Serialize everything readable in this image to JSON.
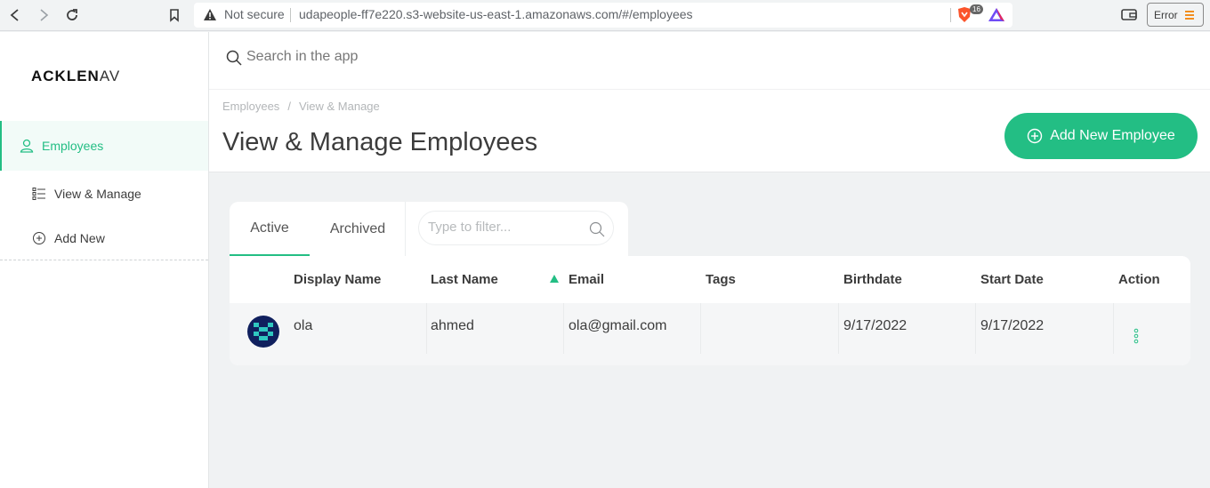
{
  "browser": {
    "not_secure": "Not secure",
    "url": "udapeople-ff7e220.s3-website-us-east-1.amazonaws.com/#/employees",
    "ext_badge": "16",
    "error_label": "Error"
  },
  "sidebar": {
    "logo_bold": "ACKLEN",
    "logo_rest": "AV",
    "items": [
      {
        "label": "Employees"
      },
      {
        "label": "View & Manage"
      },
      {
        "label": "Add New"
      }
    ]
  },
  "search": {
    "placeholder": "Search in the app"
  },
  "header": {
    "breadcrumb": [
      "Employees",
      "/",
      "View & Manage"
    ],
    "title": "View & Manage Employees",
    "add_button": "Add New Employee"
  },
  "tabs": [
    {
      "label": "Active"
    },
    {
      "label": "Archived"
    }
  ],
  "filter": {
    "placeholder": "Type to filter..."
  },
  "table": {
    "columns": [
      "Display Name",
      "Last Name",
      "Email",
      "Tags",
      "Birthdate",
      "Start Date",
      "Action"
    ],
    "rows": [
      {
        "display_name": "ola",
        "last_name": "ahmed",
        "email": "ola@gmail.com",
        "tags": "",
        "birthdate": "9/17/2022",
        "start_date": "9/17/2022"
      }
    ]
  },
  "colors": {
    "accent": "#23be84"
  }
}
